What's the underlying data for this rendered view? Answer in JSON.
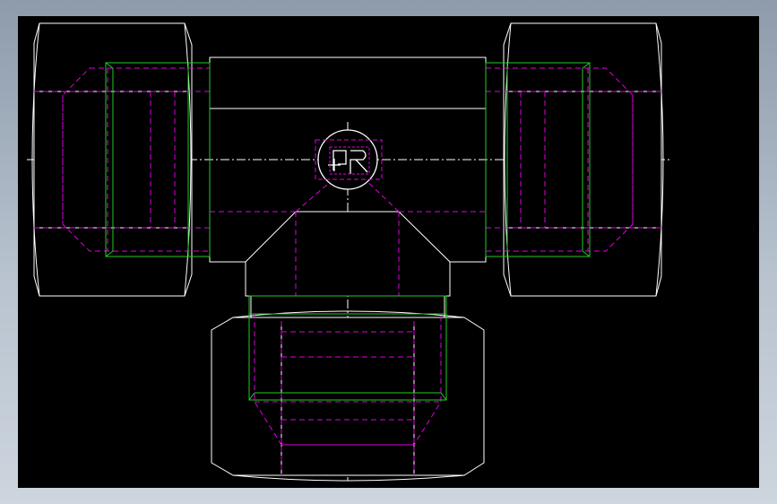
{
  "app": {
    "type": "cad-viewport"
  },
  "drawing": {
    "subject": "tee-fitting-with-three-nuts",
    "colors": {
      "background": "#000000",
      "outline": "#ffffff",
      "hidden": "#e000e0",
      "sleeve": "#22cc22",
      "centerline": "#ffffff",
      "frame": "#8d9bab"
    },
    "logo_icon": "brand-logo-icon"
  }
}
